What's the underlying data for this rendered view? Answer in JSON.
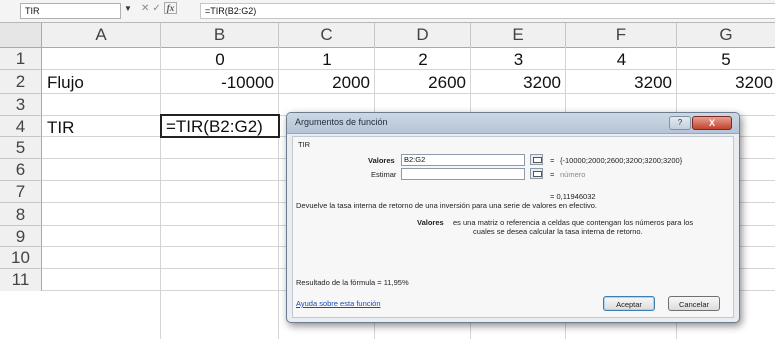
{
  "formula_bar": {
    "name_box": "TIR",
    "icons": [
      "dropdown-arrow-icon",
      "cancel-icon",
      "confirm-icon",
      "fx-icon"
    ],
    "formula": "=TIR(B2:G2)"
  },
  "sheet": {
    "columns": [
      "A",
      "B",
      "C",
      "D",
      "E",
      "F",
      "G"
    ],
    "rows": [
      "1",
      "2",
      "3",
      "4",
      "5",
      "6",
      "7",
      "8",
      "9",
      "10",
      "11"
    ],
    "cells": {
      "B1": "0",
      "C1": "1",
      "D1": "2",
      "E1": "3",
      "F1": "4",
      "G1": "5",
      "A2": "Flujo",
      "B2": "-10000",
      "C2": "2000",
      "D2": "2600",
      "E2": "3200",
      "F2": "3200",
      "G2": "3200",
      "A4": "TIR",
      "B4": "=TIR(B2:G2)"
    }
  },
  "dialog": {
    "title": "Argumentos de función",
    "function_name": "TIR",
    "arg1_label": "Valores",
    "arg1_value": "B2:G2",
    "arg1_result": "{-10000;2000;2600;3200;3200;3200}",
    "arg2_label": "Estimar",
    "arg2_value": "",
    "arg2_result": "número",
    "equals": "=",
    "result_value": "= 0,11946032",
    "description": "Devuelve la tasa interna de retorno de una inversión para una serie de valores en efectivo.",
    "arg_help_name": "Valores",
    "arg_help_line1": "es una matriz o referencia a celdas que contengan los números para los",
    "arg_help_line2": "cuales se desea calcular la tasa interna de retorno.",
    "formula_result": "Resultado de la fórmula =   11,95%",
    "help_link": "Ayuda sobre esta función",
    "ok_button": "Aceptar",
    "cancel_button": "Cancelar",
    "help_button": "?",
    "close_button": "X"
  }
}
